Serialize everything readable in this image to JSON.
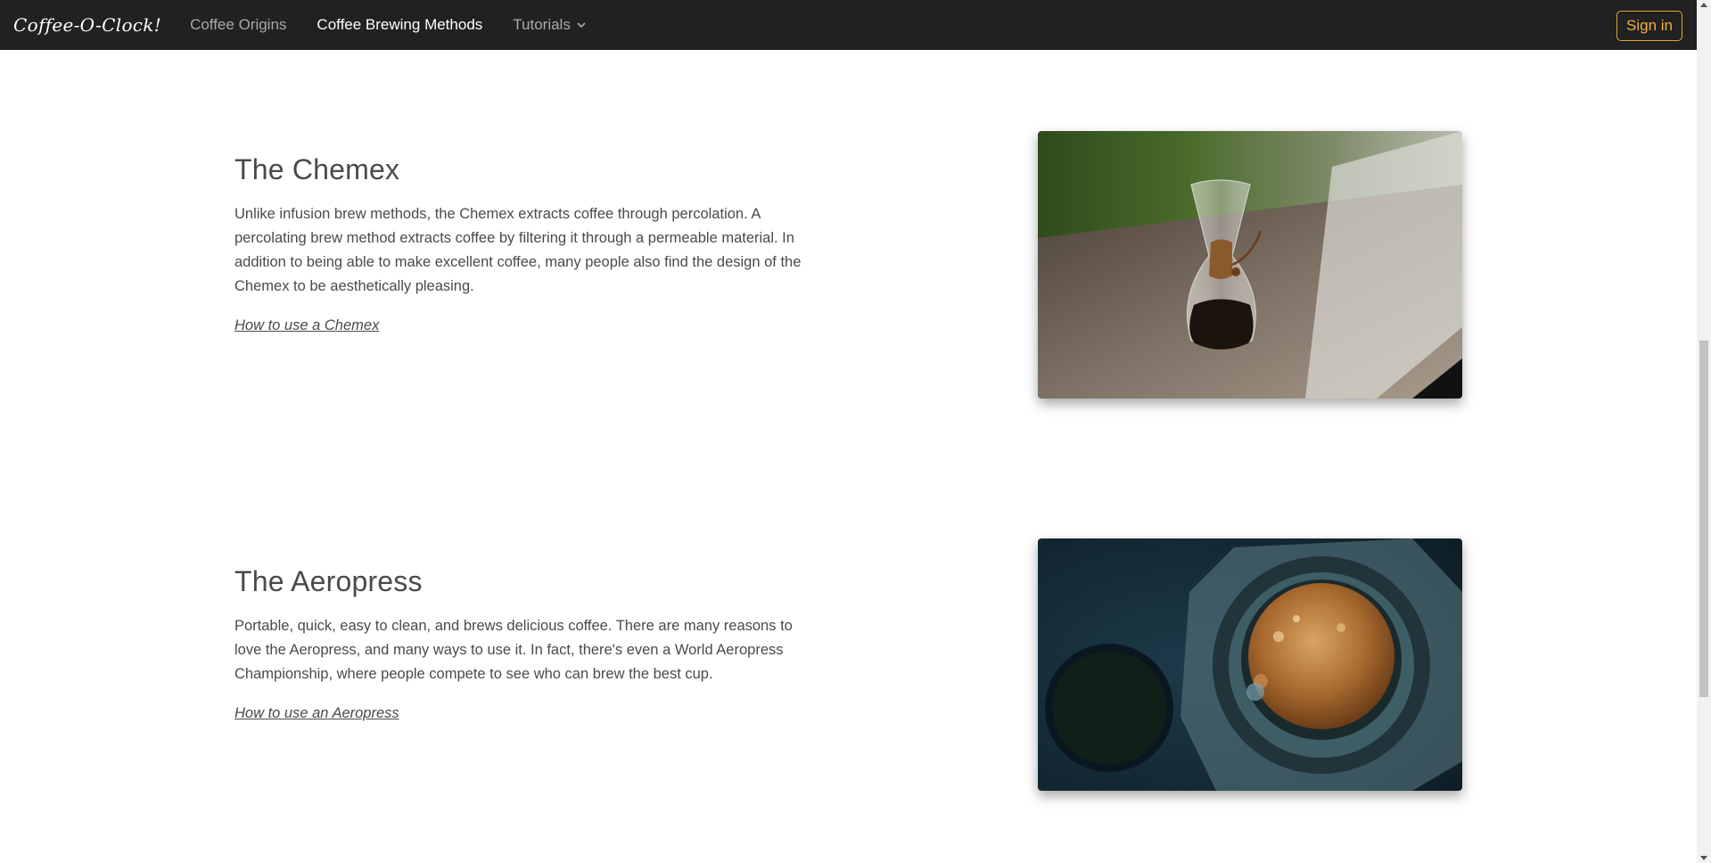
{
  "navbar": {
    "brand": "Coffee-O-Clock!",
    "links": [
      {
        "label": "Coffee Origins",
        "active": false
      },
      {
        "label": "Coffee Brewing Methods",
        "active": true
      },
      {
        "label": "Tutorials",
        "active": false,
        "dropdown": true
      }
    ],
    "signin_label": "Sign in"
  },
  "sections": [
    {
      "title": "The Chemex",
      "text": "Unlike infusion brew methods, the Chemex extracts coffee through percolation. A percolating brew method extracts coffee by filtering it through a permeable material. In addition to being able to make excellent coffee, many people also find the design of the Chemex to be aesthetically pleasing.",
      "link": "How to use a Chemex",
      "image_icon": "chemex-photo"
    },
    {
      "title": "The Aeropress",
      "text": "Portable, quick, easy to clean, and brews delicious coffee. There are many reasons to love the Aeropress, and many ways to use it. In fact, there's even a World Aeropress Championship, where people compete to see who can brew the best cup.",
      "link": "How to use an Aeropress",
      "image_icon": "aeropress-photo"
    }
  ],
  "colors": {
    "navbar_bg": "#212121",
    "accent": "#f0b040",
    "text": "#4a4a4a"
  }
}
